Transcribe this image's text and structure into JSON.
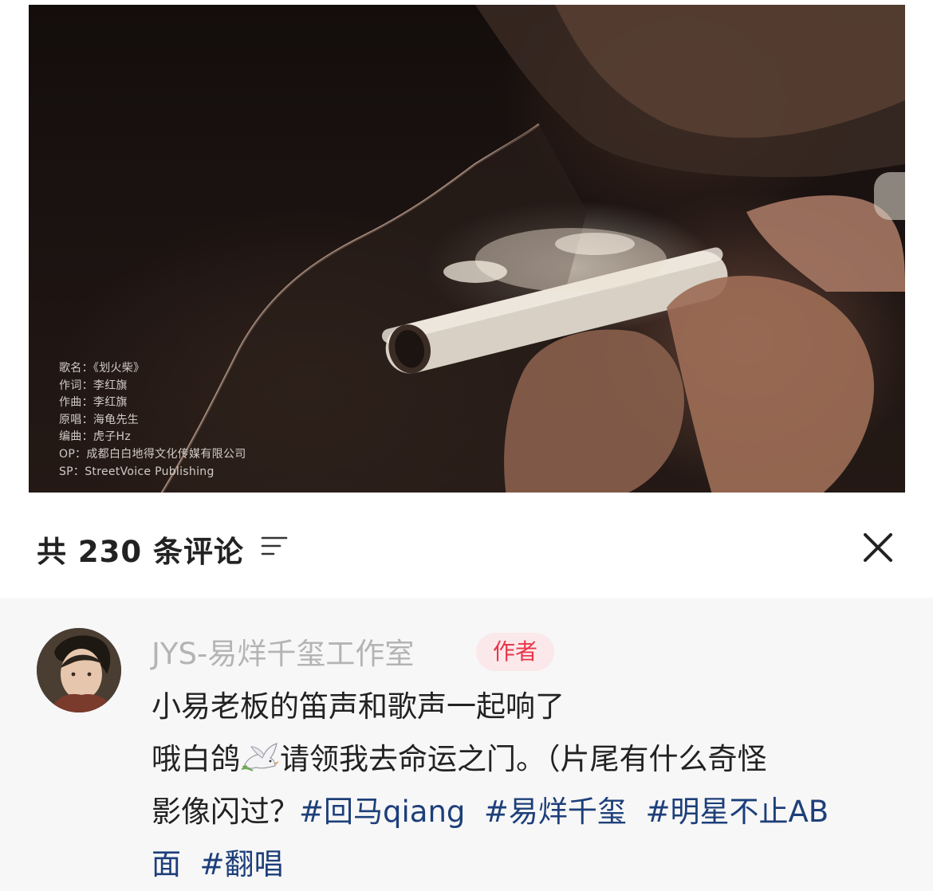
{
  "video": {
    "credits": [
      "歌名：《划火柴》",
      "作词：李红旗",
      "作曲：李红旗",
      "原唱：海龟先生",
      "编曲：虎子Hz",
      "OP：成都白白地得文化传媒有限公司",
      "SP：StreetVoice Publishing"
    ]
  },
  "comments_panel": {
    "count_label": "共 230 条评论",
    "sort_icon": "sort-lines-icon",
    "close_icon": "close-icon"
  },
  "comment": {
    "author": "JYS-易烊千玺工作室",
    "badge": "作者",
    "line1": "小易老板的笛声和歌声一起响了",
    "line2_before_emoji": "哦白鸽",
    "emoji": "dove-emoji",
    "line2_after_emoji": "请领我去命运之门。（片尾有什么奇怪",
    "line3_text": "影像闪过？",
    "hashtags": [
      "#回马qiang",
      "#易烊千玺",
      "#明星不止AB面",
      "#翻唱"
    ],
    "hashtag_3_part1": "#明星不止AB",
    "hashtag_3_part2": "面"
  },
  "colors": {
    "hashtag": "#1d3f7a",
    "badge_text": "#e8364a",
    "badge_bg": "#fbe8ea",
    "author_name": "#b4b4b4",
    "comment_bg": "#f7f7f7"
  }
}
